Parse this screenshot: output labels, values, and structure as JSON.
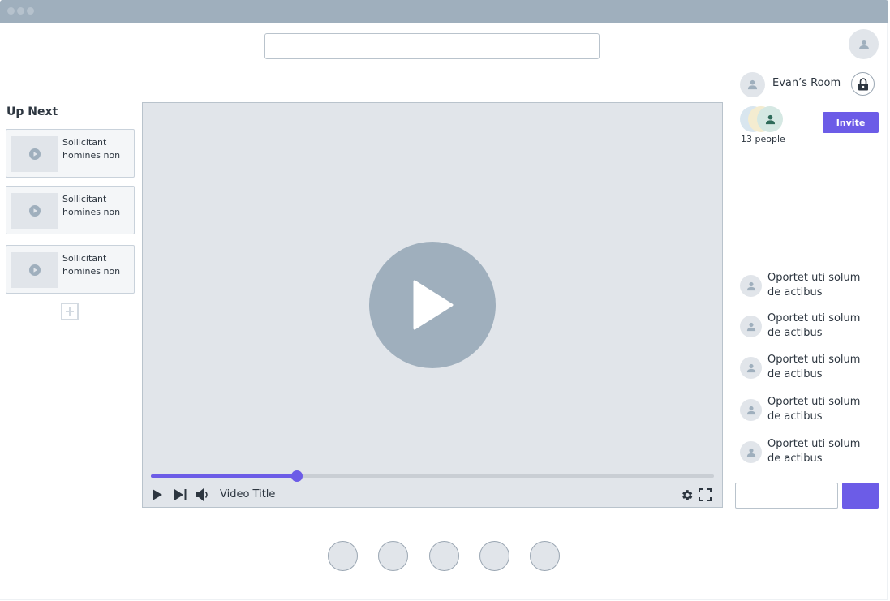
{
  "window": {
    "controls": [
      "window-dot",
      "window-dot",
      "window-dot"
    ]
  },
  "search": {
    "value": "",
    "placeholder": ""
  },
  "room": {
    "name": "Evan’s Room",
    "people_count": "13 people",
    "invite_label": "Invite",
    "locked": true
  },
  "up_next": {
    "title": "Up Next",
    "items": [
      {
        "title": "Sollicitant homines non"
      },
      {
        "title": "Sollicitant homines non"
      },
      {
        "title": "Sollicitant homines non"
      }
    ]
  },
  "player": {
    "video_title": "Video Title",
    "progress": 0.26
  },
  "chat": {
    "messages": [
      {
        "text": "Oportet uti solum de actibus"
      },
      {
        "text": "Oportet uti solum de actibus"
      },
      {
        "text": "Oportet uti solum de actibus"
      },
      {
        "text": "Oportet uti solum de actibus"
      },
      {
        "text": "Oportet uti solum de actibus"
      }
    ],
    "input_value": "",
    "input_placeholder": ""
  },
  "colors": {
    "accent": "#6c5ce7",
    "placeholder_gray": "#9fafbd",
    "surface": "#e1e5ea",
    "titlebar": "#9fafbd"
  },
  "icons": [
    "user-icon",
    "lock-icon",
    "play-icon",
    "next-icon",
    "volume-icon",
    "settings-icon",
    "fullscreen-icon",
    "plus-icon"
  ],
  "bottom_dock": {
    "count": 5
  }
}
